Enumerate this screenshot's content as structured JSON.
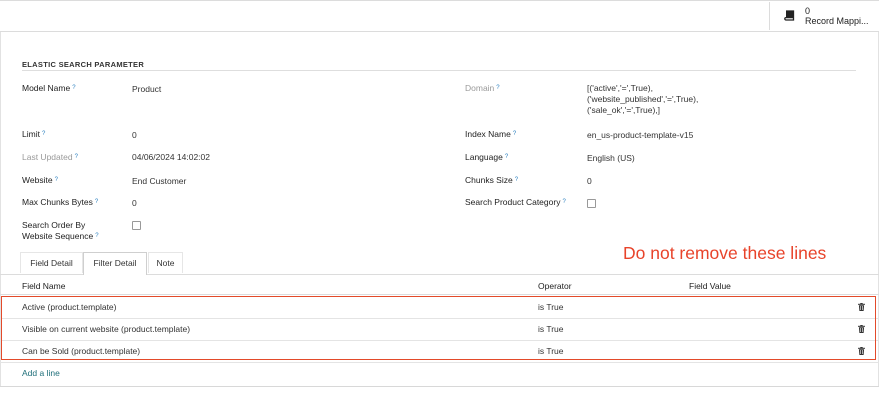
{
  "smart_button": {
    "count": "0",
    "label": "Record Mappi..."
  },
  "section_title": "ELASTIC SEARCH PARAMETER",
  "left_fields": [
    {
      "label": "Model Name",
      "help": "?",
      "value": "Product"
    },
    {
      "label": "Limit",
      "help": "?",
      "value": "0"
    },
    {
      "label": "Last Updated",
      "help": "?",
      "value": "04/06/2024 14:02:02"
    },
    {
      "label": "Website",
      "help": "?",
      "value": "End Customer"
    },
    {
      "label": "Max Chunks Bytes",
      "help": "?",
      "value": "0"
    }
  ],
  "search_order": {
    "label_line1": "Search Order By",
    "label_line2": "Website Sequence",
    "help": "?"
  },
  "right_fields": {
    "domain": {
      "label": "Domain",
      "help": "?",
      "line1": "[('active','=',True),",
      "line2": "('website_published','=',True),",
      "line3": "('sale_ok','=',True),]"
    },
    "index_name": {
      "label": "Index Name",
      "help": "?",
      "value": "en_us-product-template-v15"
    },
    "language": {
      "label": "Language",
      "help": "?",
      "value": "English (US)"
    },
    "chunks_size": {
      "label": "Chunks Size",
      "help": "?",
      "value": "0"
    },
    "search_category": {
      "label": "Search Product Category",
      "help": "?"
    }
  },
  "tabs": [
    "Field Detail",
    "Filter Detail",
    "Note"
  ],
  "table": {
    "headers": [
      "Field Name",
      "Operator",
      "Field Value"
    ],
    "rows": [
      {
        "field": "Active (product.template)",
        "operator": "is True",
        "value": ""
      },
      {
        "field": "Visible on current website (product.template)",
        "operator": "is True",
        "value": ""
      },
      {
        "field": "Can be Sold (product.template)",
        "operator": "is True",
        "value": ""
      }
    ],
    "add_line": "Add a line"
  },
  "annotation": "Do not remove these lines",
  "colors": {
    "annotation": "#e8432a",
    "link": "#1f6f7a",
    "help": "#2a7fbf"
  },
  "icons": [
    "book-icon",
    "trash-icon"
  ]
}
